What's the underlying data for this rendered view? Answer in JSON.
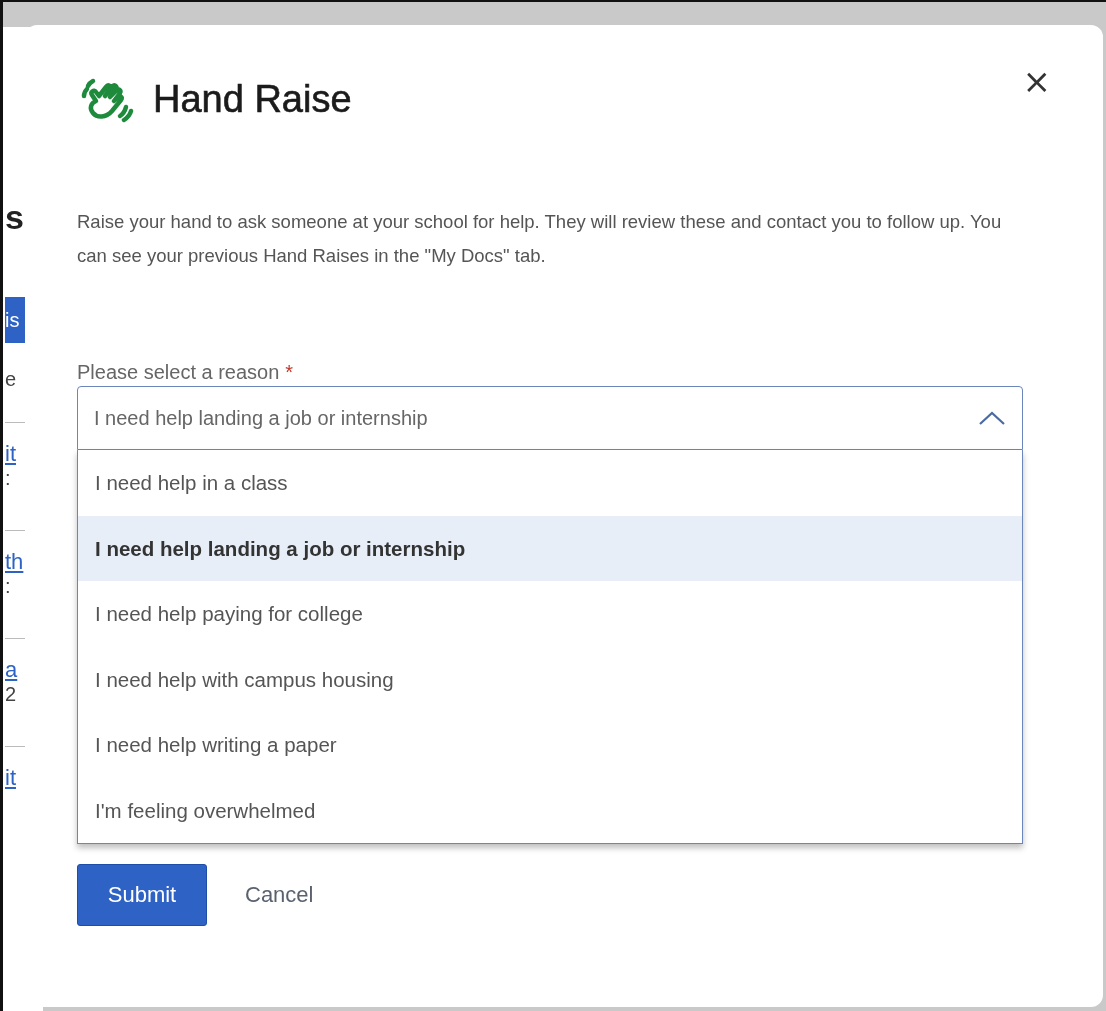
{
  "background_page": [
    {
      "kind": "heading",
      "text": "s"
    },
    {
      "kind": "button",
      "text": "is"
    },
    {
      "kind": "text",
      "text": "e"
    },
    {
      "kind": "divider"
    },
    {
      "kind": "link",
      "text": "it"
    },
    {
      "kind": "subtext",
      "text": ":"
    },
    {
      "kind": "divider"
    },
    {
      "kind": "link",
      "text": "th"
    },
    {
      "kind": "subtext",
      "text": ":"
    },
    {
      "kind": "divider"
    },
    {
      "kind": "link",
      "text": "a"
    },
    {
      "kind": "subtext",
      "text": "2"
    },
    {
      "kind": "divider"
    },
    {
      "kind": "link",
      "text": "it"
    }
  ],
  "dialog": {
    "title": "Hand Raise",
    "close": "×",
    "description": "Raise your hand to ask someone at your school for help. They will review these and contact you to follow up. You can see your previous Hand Raises in the \"My Docs\" tab.",
    "reason_field": {
      "label": "Please select a reason",
      "required_mark": "*",
      "value": "I need help landing a job or internship",
      "expanded": true,
      "options": [
        {
          "label": "I need help in a class",
          "selected": false
        },
        {
          "label": "I need help landing a job or internship",
          "selected": true
        },
        {
          "label": "I need help paying for college",
          "selected": false
        },
        {
          "label": "I need help with campus housing",
          "selected": false
        },
        {
          "label": "I need help writing a paper",
          "selected": false
        },
        {
          "label": "I'm feeling overwhelmed",
          "selected": false
        }
      ]
    },
    "buttons": [
      {
        "label": "Submit",
        "kind": "primary"
      },
      {
        "label": "Cancel",
        "kind": "link"
      }
    ]
  }
}
